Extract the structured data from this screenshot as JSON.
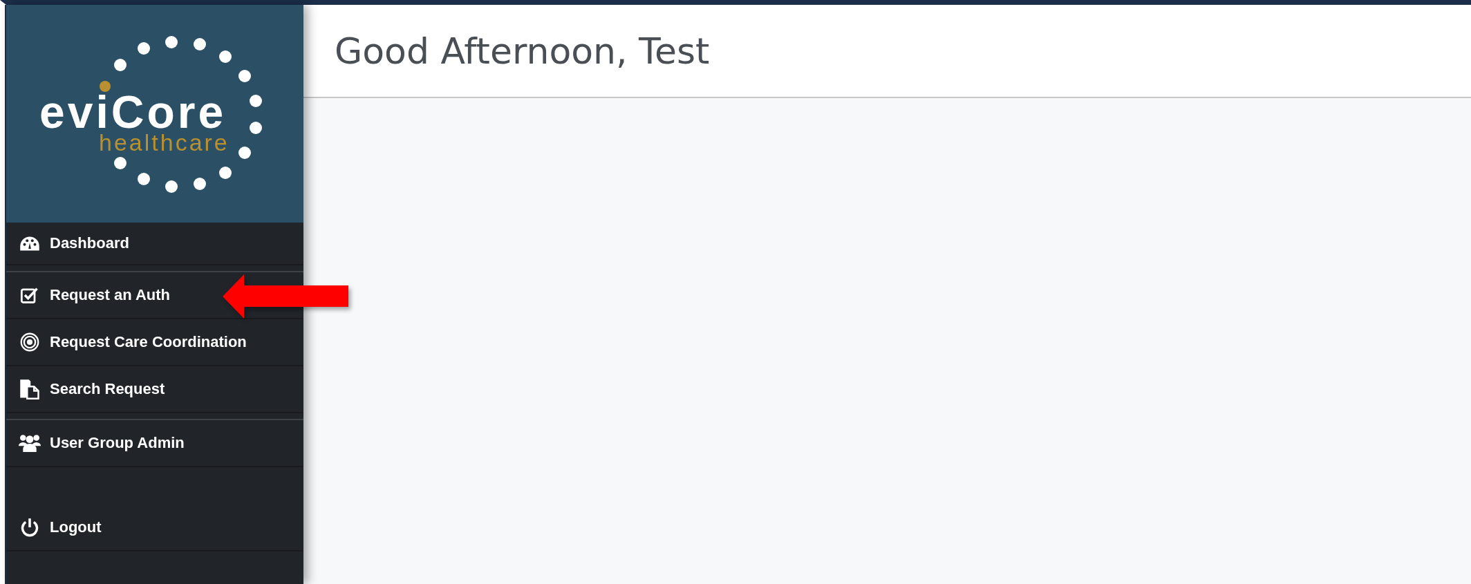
{
  "logo": {
    "name": "eviCore",
    "tagline": "healthcare"
  },
  "sidebar": {
    "groups": [
      [
        {
          "label": "Dashboard"
        }
      ],
      [
        {
          "label": "Request an Auth"
        },
        {
          "label": "Request Care Coordination"
        },
        {
          "label": "Search Request"
        }
      ],
      [
        {
          "label": "User Group Admin"
        }
      ]
    ],
    "footer": [
      {
        "label": "Logout"
      }
    ]
  },
  "header": {
    "greeting": "Good Afternoon, Test"
  }
}
